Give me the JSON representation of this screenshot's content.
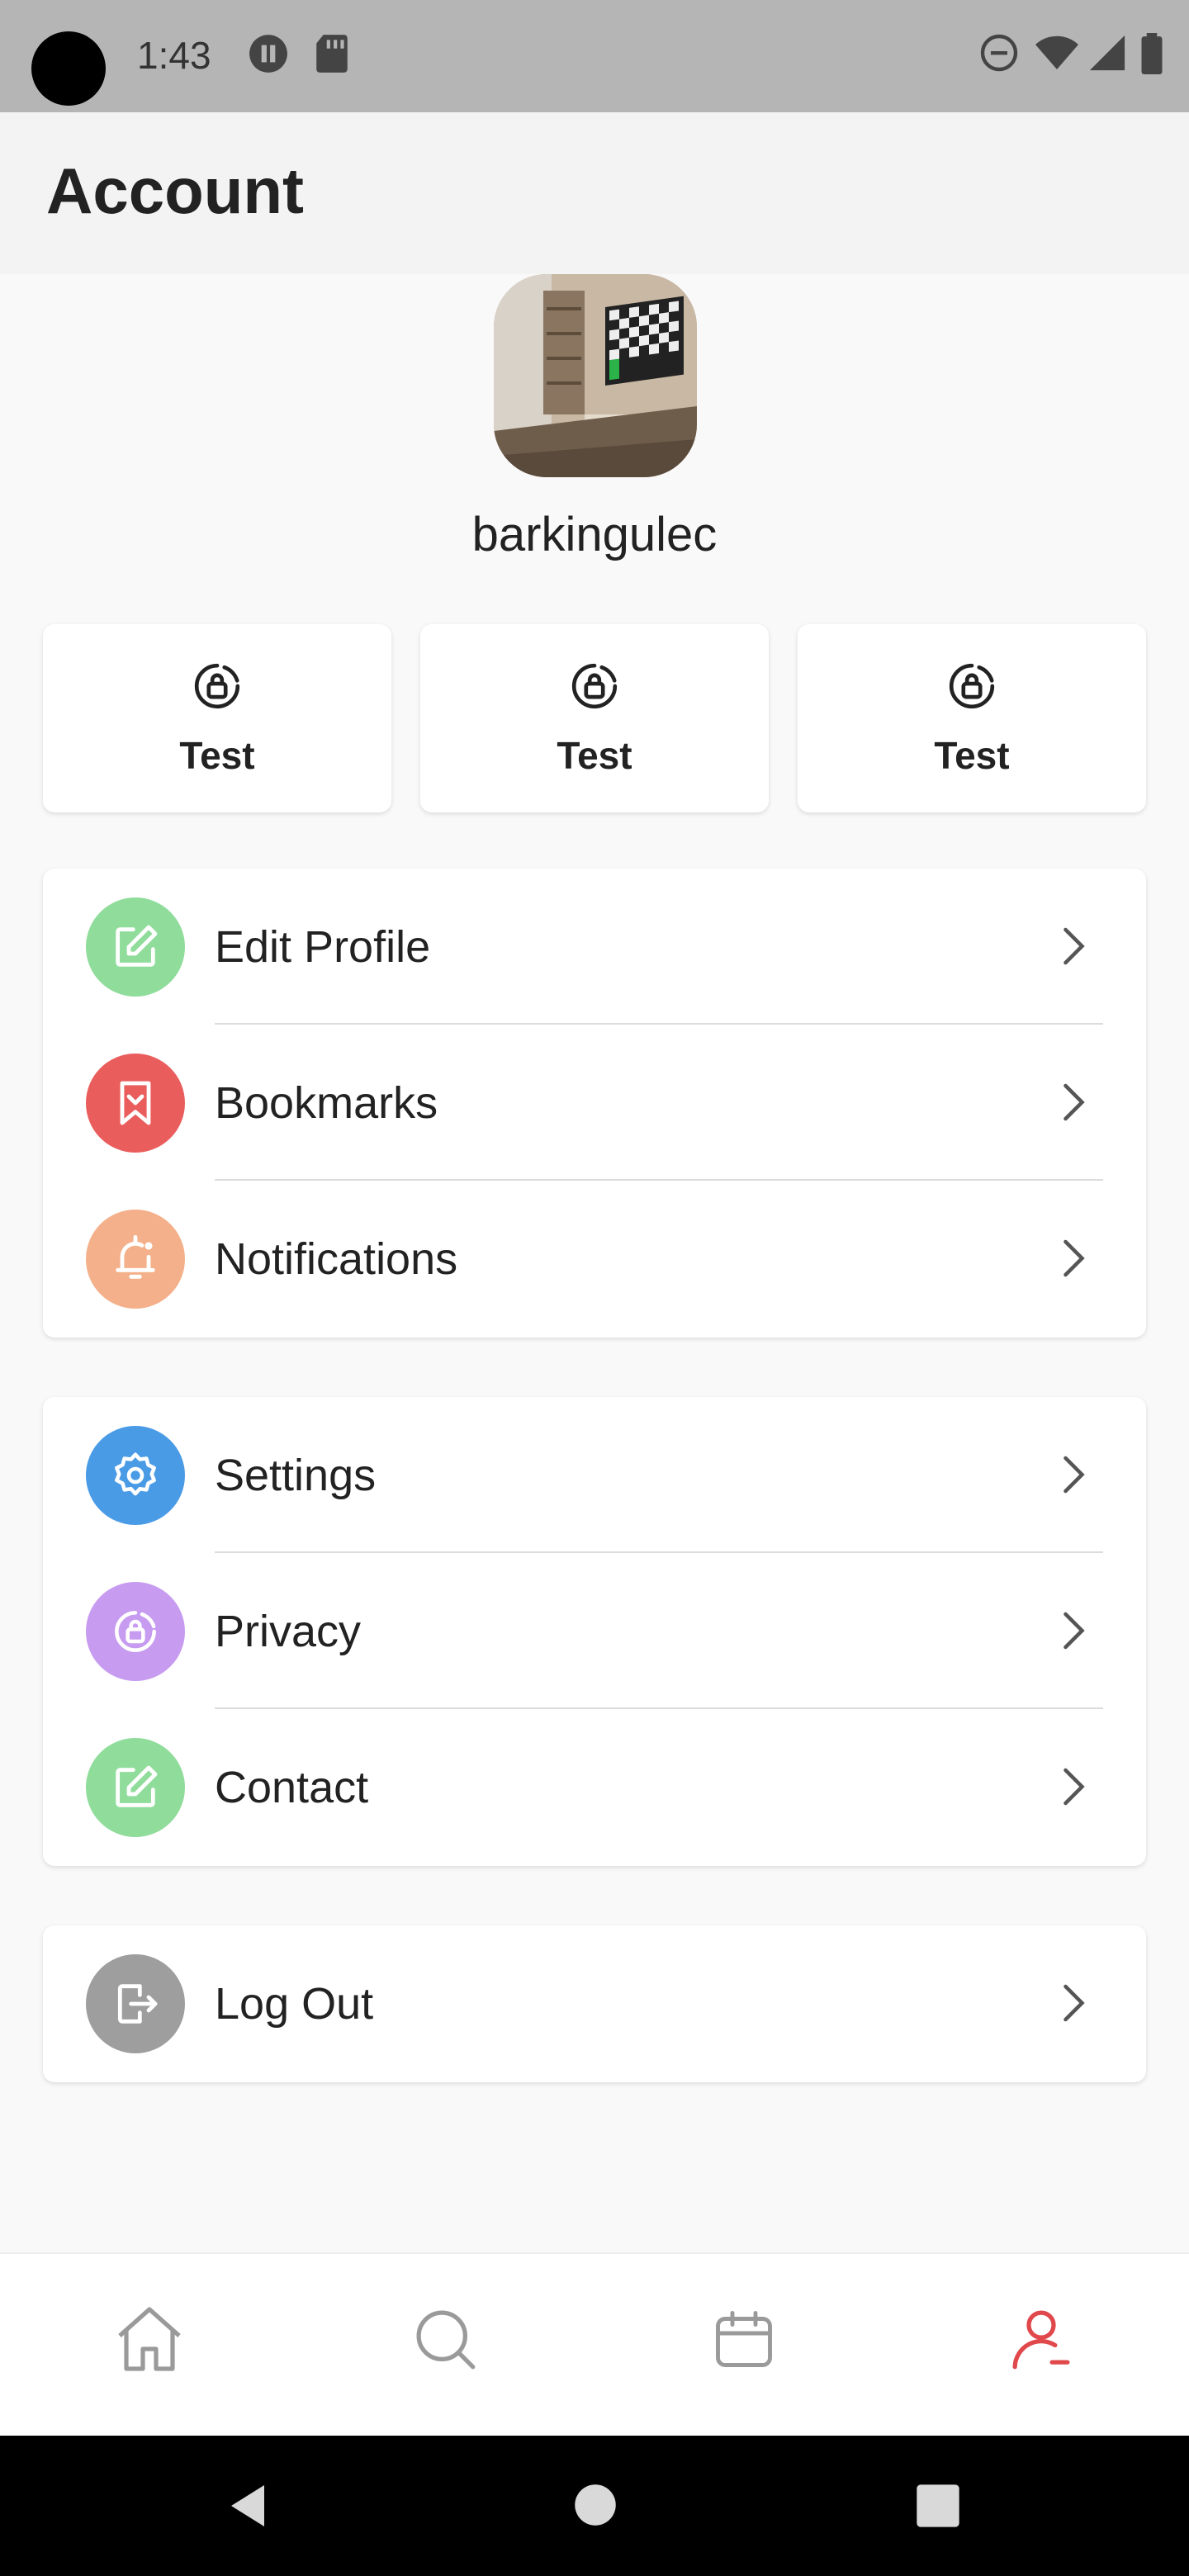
{
  "status_bar": {
    "time": "1:43",
    "left_icons": [
      "pause-circle-icon",
      "sd-card-icon"
    ],
    "right_icons": [
      "do-not-disturb-icon",
      "wifi-icon",
      "signal-icon",
      "battery-icon"
    ]
  },
  "appbar": {
    "title": "Account"
  },
  "profile": {
    "username": "barkingulec"
  },
  "quick_actions": [
    {
      "label": "Test",
      "icon": "lock-circle-icon"
    },
    {
      "label": "Test",
      "icon": "lock-circle-icon"
    },
    {
      "label": "Test",
      "icon": "lock-circle-icon"
    }
  ],
  "menu_group_1": [
    {
      "label": "Edit Profile",
      "icon": "edit-icon",
      "color": "#8fdc9b"
    },
    {
      "label": "Bookmarks",
      "icon": "bookmark-icon",
      "color": "#ea5d5d"
    },
    {
      "label": "Notifications",
      "icon": "bell-icon",
      "color": "#f4b08a"
    }
  ],
  "menu_group_2": [
    {
      "label": "Settings",
      "icon": "gear-icon",
      "color": "#4a9be6"
    },
    {
      "label": "Privacy",
      "icon": "lock-circle-icon",
      "color": "#c69bf0"
    },
    {
      "label": "Contact",
      "icon": "edit-icon",
      "color": "#8fdc9b"
    }
  ],
  "menu_group_3": [
    {
      "label": "Log Out",
      "icon": "logout-icon",
      "color": "#9e9e9e"
    }
  ],
  "bottom_nav": [
    {
      "icon": "home-icon",
      "active": false
    },
    {
      "icon": "search-icon",
      "active": false
    },
    {
      "icon": "calendar-icon",
      "active": false
    },
    {
      "icon": "profile-icon",
      "active": true
    }
  ],
  "colors": {
    "active_nav": "#e0484c",
    "inactive_nav": "#9a9a9a"
  }
}
